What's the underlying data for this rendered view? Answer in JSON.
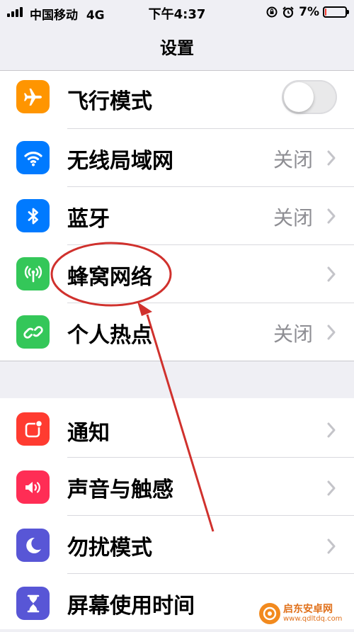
{
  "status_bar": {
    "carrier": "中国移动",
    "network": "4G",
    "time": "下午4:37",
    "battery_percent": "7%",
    "battery_level": 0.07
  },
  "nav": {
    "title": "设置"
  },
  "settings": {
    "airplane": {
      "label": "飞行模式",
      "icon": "airplane-icon",
      "color": "#ff9500",
      "toggle": "off"
    },
    "wifi": {
      "label": "无线局域网",
      "value": "关闭",
      "icon": "wifi-icon",
      "color": "#007aff"
    },
    "bluetooth": {
      "label": "蓝牙",
      "value": "关闭",
      "icon": "bluetooth-icon",
      "color": "#007aff"
    },
    "cellular": {
      "label": "蜂窝网络",
      "icon": "cellular-antenna-icon",
      "color": "#34c759"
    },
    "hotspot": {
      "label": "个人热点",
      "value": "关闭",
      "icon": "hotspot-link-icon",
      "color": "#34c759"
    },
    "notifications": {
      "label": "通知",
      "icon": "notifications-icon",
      "color": "#ff3b30"
    },
    "sounds": {
      "label": "声音与触感",
      "icon": "speaker-icon",
      "color": "#ff2d55"
    },
    "dnd": {
      "label": "勿扰模式",
      "icon": "moon-icon",
      "color": "#5856d6"
    },
    "screen_time": {
      "label": "屏幕使用时间",
      "icon": "hourglass-icon",
      "color": "#5856d6"
    }
  },
  "annotation": {
    "color": "#d0312d"
  },
  "watermark": {
    "name": "启东安卓网",
    "url": "www.qdltdq.com"
  }
}
